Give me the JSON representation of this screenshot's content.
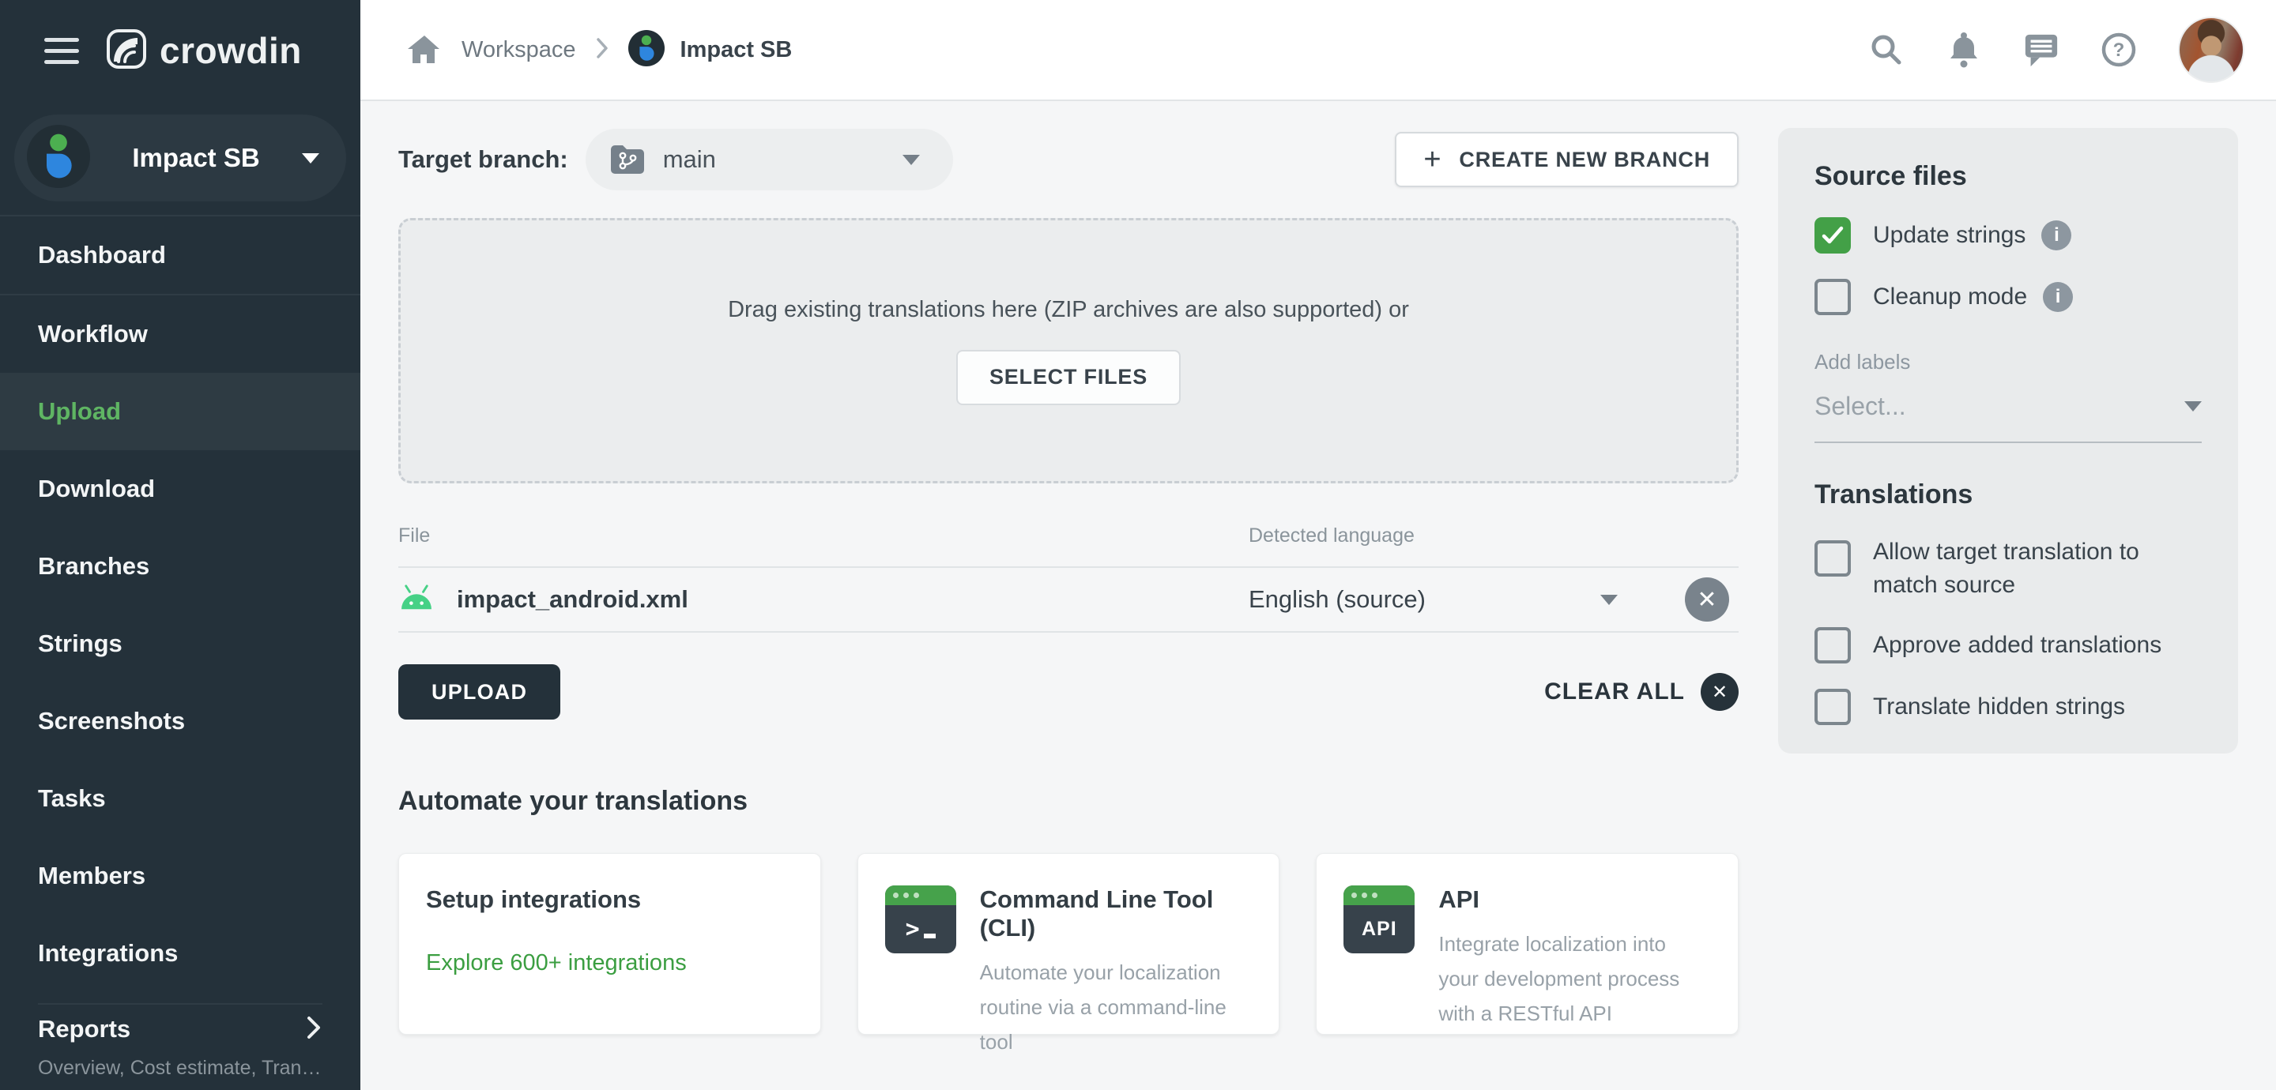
{
  "colors": {
    "sidebar_bg": "#24313A",
    "accent_green": "#43A047",
    "nav_active_green": "#5FB563",
    "link_green": "#3B9E41",
    "android_green": "#46D186"
  },
  "sidebar": {
    "logo_text": "crowdin",
    "project_switcher": {
      "name": "Impact SB"
    },
    "nav": [
      {
        "label": "Dashboard"
      },
      {
        "label": "Workflow"
      },
      {
        "label": "Upload",
        "active": true
      },
      {
        "label": "Download"
      },
      {
        "label": "Branches"
      },
      {
        "label": "Strings"
      },
      {
        "label": "Screenshots"
      },
      {
        "label": "Tasks"
      },
      {
        "label": "Members"
      },
      {
        "label": "Integrations"
      }
    ],
    "reports": {
      "label": "Reports",
      "subtitle": "Overview, Cost estimate, Transl…"
    }
  },
  "topbar": {
    "breadcrumb": {
      "workspace": "Workspace",
      "project": "Impact SB"
    },
    "icons": [
      "search-icon",
      "notifications-bell-icon",
      "messages-icon",
      "help-icon",
      "user-avatar"
    ]
  },
  "branch_bar": {
    "label": "Target branch:",
    "selected_branch": "main",
    "create_button": {
      "plus": "+",
      "label": "CREATE NEW BRANCH"
    }
  },
  "dropzone": {
    "text": "Drag existing translations here (ZIP archives are also supported) or",
    "select_button": "SELECT FILES"
  },
  "files": {
    "headers": {
      "file": "File",
      "language": "Detected language"
    },
    "rows": [
      {
        "name": "impact_android.xml",
        "language": "English (source)",
        "icon": "android-icon"
      }
    ]
  },
  "actions": {
    "upload": "UPLOAD",
    "clear_all": "CLEAR ALL"
  },
  "automate": {
    "title": "Automate your translations",
    "cards": [
      {
        "title": "Setup integrations",
        "link": "Explore 600+ integrations"
      },
      {
        "title": "Command Line Tool (CLI)",
        "description": "Automate your localization routine via a command-line tool",
        "icon": "terminal-icon"
      },
      {
        "title": "API",
        "description": "Integrate localization into your development process with a RESTful API",
        "icon": "api-icon",
        "icon_label": "API"
      }
    ]
  },
  "panel": {
    "source_files": {
      "title": "Source files",
      "options": [
        {
          "label": "Update strings",
          "checked": true,
          "info": true
        },
        {
          "label": "Cleanup mode",
          "checked": false,
          "info": true
        }
      ],
      "add_labels": "Add labels",
      "labels_placeholder": "Select..."
    },
    "translations": {
      "title": "Translations",
      "options": [
        {
          "label": "Allow target translation to match source",
          "checked": false
        },
        {
          "label": "Approve added translations",
          "checked": false
        },
        {
          "label": "Translate hidden strings",
          "checked": false
        }
      ]
    }
  }
}
